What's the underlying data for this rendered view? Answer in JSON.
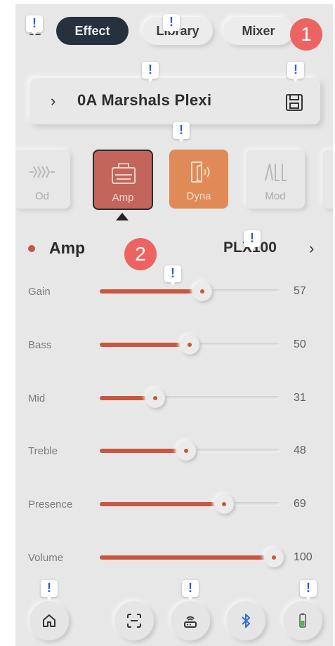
{
  "tabs": {
    "effect": "Effect",
    "library": "Library",
    "mixer": "Mixer"
  },
  "annotations": [
    "1",
    "2"
  ],
  "preset": {
    "name": "0A Marshals Plexi"
  },
  "blocks": {
    "od": "Od",
    "amp": "Amp",
    "dyna": "Dyna",
    "mod": "Mod"
  },
  "section": {
    "title": "Amp",
    "model": "PLX100"
  },
  "params": {
    "gain": {
      "label": "Gain",
      "value": 57
    },
    "bass": {
      "label": "Bass",
      "value": 50
    },
    "mid": {
      "label": "Mid",
      "value": 31
    },
    "treble": {
      "label": "Treble",
      "value": 48
    },
    "presence": {
      "label": "Presence",
      "value": 69
    },
    "volume": {
      "label": "Volume",
      "value": 100
    }
  },
  "marker_glyph": "!",
  "colors": {
    "accent": "#c9563d",
    "active_tab": "#263140",
    "amp_block": "#c4655b",
    "dyna_block": "#df8a57",
    "badge": "#ec6461",
    "marker_icon": "#2f5bd8"
  }
}
